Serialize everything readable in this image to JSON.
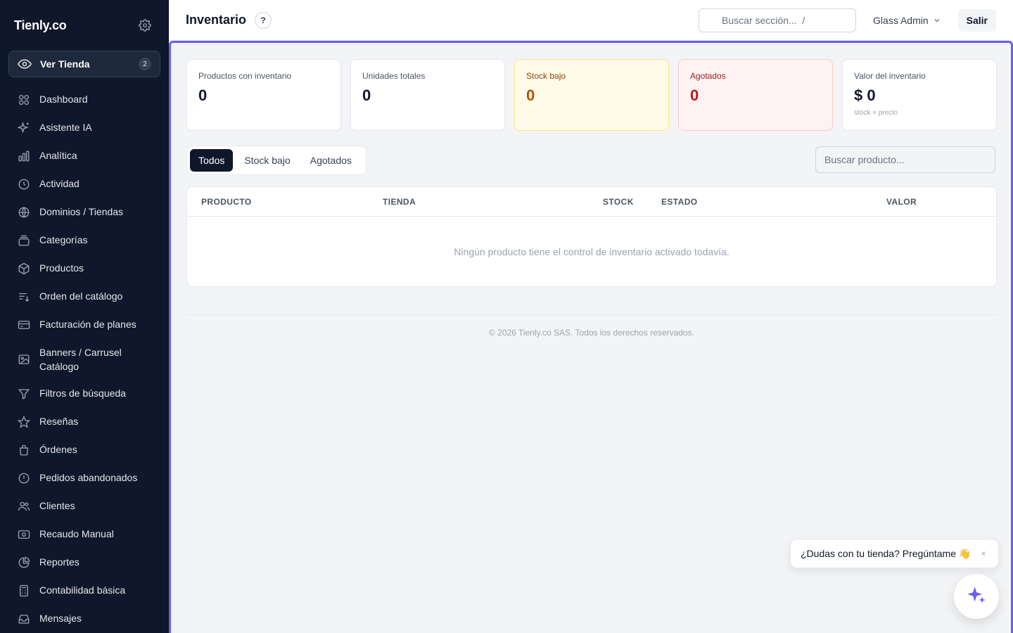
{
  "app": {
    "brand": "Tienly.co"
  },
  "sidebar": {
    "ver_tienda": {
      "label": "Ver Tienda",
      "badge": "2"
    },
    "items": [
      {
        "label": "Dashboard",
        "icon": "grid-icon"
      },
      {
        "label": "Asistente IA",
        "icon": "sparkle-icon"
      },
      {
        "label": "Analítica",
        "icon": "bar-chart-icon"
      },
      {
        "label": "Actividad",
        "icon": "clock-icon"
      },
      {
        "label": "Dominios / Tiendas",
        "icon": "globe-icon"
      },
      {
        "label": "Categorías",
        "icon": "layers-icon"
      },
      {
        "label": "Productos",
        "icon": "box-icon"
      },
      {
        "label": "Orden del catálogo",
        "icon": "sort-list-icon"
      },
      {
        "label": "Facturación de planes",
        "icon": "credit-card-icon"
      },
      {
        "label": "Banners / Carrusel Catálogo",
        "icon": "image-icon"
      },
      {
        "label": "Filtros de búsqueda",
        "icon": "filter-icon"
      },
      {
        "label": "Reseñas",
        "icon": "star-icon"
      },
      {
        "label": "Órdenes",
        "icon": "shopping-bag-icon"
      },
      {
        "label": "Pedidos abandonados",
        "icon": "alert-circle-icon"
      },
      {
        "label": "Clientes",
        "icon": "users-icon"
      },
      {
        "label": "Recaudo Manual",
        "icon": "banknote-icon"
      },
      {
        "label": "Reportes",
        "icon": "pie-chart-icon"
      },
      {
        "label": "Contabilidad básica",
        "icon": "calculator-icon"
      },
      {
        "label": "Mensajes",
        "icon": "inbox-icon"
      }
    ]
  },
  "topbar": {
    "title": "Inventario",
    "help": "?",
    "search_placeholder": "Buscar sección...  /",
    "user": "Glass Admin",
    "logout": "Salir"
  },
  "stats": [
    {
      "label": "Productos con inventario",
      "value": "0",
      "note": ""
    },
    {
      "label": "Unidades totales",
      "value": "0",
      "note": ""
    },
    {
      "label": "Stock bajo",
      "value": "0",
      "note": ""
    },
    {
      "label": "Agotados",
      "value": "0",
      "note": ""
    },
    {
      "label": "Valor del inventario",
      "value": "$ 0",
      "note": "stock × precio"
    }
  ],
  "filters": {
    "tabs": [
      "Todos",
      "Stock bajo",
      "Agotados"
    ],
    "active_tab": "Todos",
    "search_placeholder": "Buscar producto..."
  },
  "table": {
    "columns": [
      "PRODUCTO",
      "TIENDA",
      "STOCK",
      "ESTADO",
      "VALOR"
    ],
    "empty_message": "Ningún producto tiene el control de inventario activado todavía."
  },
  "footer": {
    "text": "© 2026 Tienly.co SAS. Todos los derechos reservados."
  },
  "chat": {
    "message": "¿Dudas con tu tienda? Pregúntame 👋",
    "close": "×"
  },
  "colors": {
    "sidebar_bg": "#0f172a",
    "accent": "#6d5cf5",
    "warning": "#b45309",
    "danger": "#b91c1c"
  }
}
